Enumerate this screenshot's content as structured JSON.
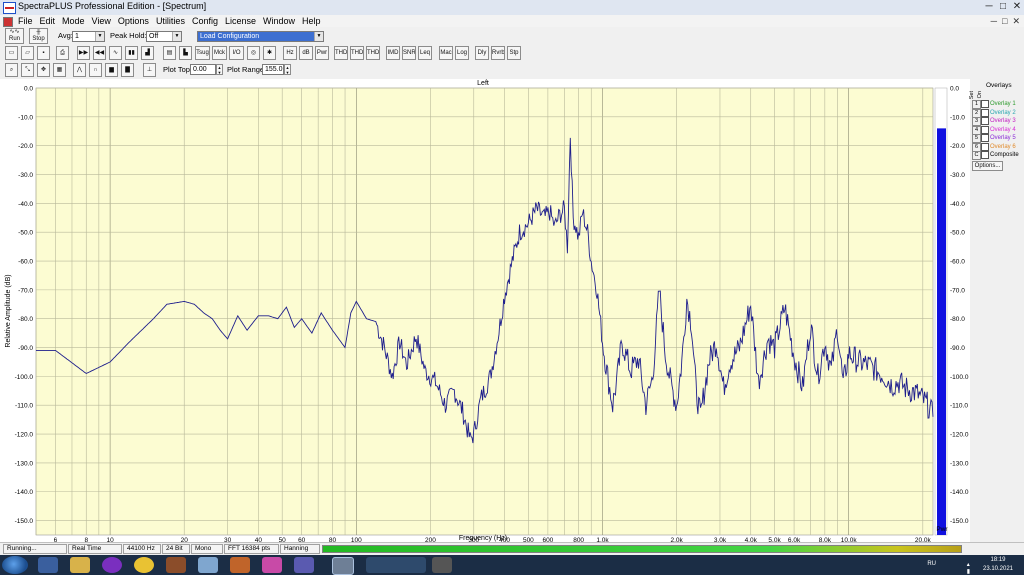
{
  "window": {
    "title": "SpectraPLUS Professional Edition - [Spectrum]",
    "buttons": [
      "─",
      "□",
      "✕"
    ]
  },
  "menu": {
    "items": [
      "File",
      "Edit",
      "Mode",
      "View",
      "Options",
      "Utilities",
      "Config",
      "License",
      "Window",
      "Help"
    ],
    "mdi_buttons": [
      "─",
      "□",
      "✕"
    ]
  },
  "toolbar1": {
    "run": "Run",
    "stop": "Stop",
    "avg_label": "Avg:",
    "avg_value": "1",
    "peak_hold_label": "Peak Hold:",
    "peak_hold_value": "Off",
    "config_value": "Load Configuration"
  },
  "toolbar2": {
    "buttons": [
      "Tsug",
      "Mck",
      "I/O",
      "Hz",
      "dB",
      "Pwr",
      "THD",
      "THD+N",
      "THD Freq",
      "IMD",
      "SNR",
      "Leq",
      "Mac",
      "Log",
      "Dly",
      "Rvrb",
      "Stp"
    ]
  },
  "toolbar3": {
    "plot_top_label": "Plot Top:",
    "plot_top_value": "0.00",
    "plot_range_label": "Plot Range:",
    "plot_range_value": "155.0"
  },
  "plot": {
    "title": "Left",
    "pwr_label": "Pwr"
  },
  "overlays": {
    "header": "Overlays",
    "set_label": "Set",
    "on_label": "On",
    "items": [
      {
        "num": "1",
        "name": "Overlay 1",
        "color": "#2e9b2e"
      },
      {
        "num": "2",
        "name": "Overlay 2",
        "color": "#2aa7b0"
      },
      {
        "num": "3",
        "name": "Overlay 3",
        "color": "#c21fc2"
      },
      {
        "num": "4",
        "name": "Overlay 4",
        "color": "#d62bd6"
      },
      {
        "num": "5",
        "name": "Overlay 5",
        "color": "#8a2bd6"
      },
      {
        "num": "6",
        "name": "Overlay 6",
        "color": "#e08a2c"
      },
      {
        "num": "C",
        "name": "Composite",
        "color": "#000000"
      }
    ],
    "options_button": "Options..."
  },
  "status": {
    "items": [
      "Running...",
      "Real Time",
      "44100 Hz",
      "24 Bit",
      "Mono",
      "FFT 16384 pts",
      "Hanning"
    ]
  },
  "taskbar": {
    "lang": "RU",
    "time": "18:19",
    "date": "23.10.2021"
  },
  "chart_data": {
    "type": "line",
    "title": "Left",
    "xlabel": "Frequency (Hz)",
    "ylabel": "Relative Amplitude (dB)",
    "xscale": "log",
    "xlim": [
      5,
      22000
    ],
    "ylim": [
      -155,
      0
    ],
    "x_ticks": [
      "6",
      "8",
      "10",
      "20",
      "30",
      "40",
      "50",
      "60",
      "80",
      "100",
      "200",
      "300",
      "400",
      "500",
      "600",
      "800",
      "1.0k",
      "2.0k",
      "3.0k",
      "4.0k",
      "5.0k",
      "6.0k",
      "8.0k",
      "10.0k",
      "20.0k"
    ],
    "x_tick_values": [
      6,
      8,
      10,
      20,
      30,
      40,
      50,
      60,
      80,
      100,
      200,
      300,
      400,
      500,
      600,
      800,
      1000,
      2000,
      3000,
      4000,
      5000,
      6000,
      8000,
      10000,
      20000
    ],
    "y_ticks": [
      "0.0",
      "-10.0",
      "-20.0",
      "-30.0",
      "-40.0",
      "-50.0",
      "-60.0",
      "-70.0",
      "-80.0",
      "-90.0",
      "-100.0",
      "-110.0",
      "-120.0",
      "-130.0",
      "-140.0",
      "-150.0"
    ],
    "y_tick_values": [
      0,
      -10,
      -20,
      -30,
      -40,
      -50,
      -60,
      -70,
      -80,
      -90,
      -100,
      -110,
      -120,
      -130,
      -140,
      -150
    ],
    "grid": true,
    "pwr_level_db": -14,
    "series": [
      {
        "color": "#1e1e8c",
        "x": [
          5,
          6,
          8,
          10,
          12,
          15,
          17,
          20,
          22,
          24,
          26,
          28,
          30,
          33,
          36,
          40,
          44,
          48,
          52,
          56,
          60,
          66,
          72,
          80,
          90,
          95,
          100,
          110,
          120,
          130,
          140,
          150,
          160,
          175,
          190,
          210,
          230,
          250,
          270,
          290,
          300,
          320,
          350,
          380,
          400,
          430,
          460,
          500,
          540,
          580,
          610,
          640,
          670,
          700,
          720,
          740,
          760,
          780,
          800,
          830,
          870,
          900,
          950,
          1000,
          1050,
          1100,
          1150,
          1200,
          1300,
          1400,
          1500,
          1600,
          1700,
          1800,
          1900,
          2000,
          2100,
          2200,
          2300,
          2400,
          2500,
          2700,
          2900,
          3100,
          3300,
          3600,
          4000,
          4300,
          4700,
          5000,
          5500,
          6000,
          6500,
          7000,
          7500,
          8000,
          8500,
          9000,
          9500,
          10000,
          11000,
          12000,
          13000,
          14000,
          15000,
          16000,
          17000,
          18000,
          19000,
          20000,
          21000,
          22000
        ],
        "y": [
          -91,
          -91,
          -99,
          -95,
          -88,
          -80,
          -75,
          -74,
          -75,
          -78,
          -80,
          -84,
          -87,
          -79,
          -84,
          -79,
          -79,
          -80,
          -76,
          -83,
          -80,
          -85,
          -78,
          -84,
          -90,
          -78,
          -74,
          -80,
          -81,
          -90,
          -100,
          -88,
          -96,
          -86,
          -98,
          -102,
          -110,
          -105,
          -112,
          -122,
          -120,
          -108,
          -100,
          -84,
          -72,
          -60,
          -50,
          -47,
          -42,
          -45,
          -43,
          -48,
          -44,
          -42,
          -55,
          -16,
          -45,
          -48,
          -52,
          -43,
          -50,
          -60,
          -70,
          -88,
          -100,
          -110,
          -100,
          -88,
          -98,
          -94,
          -110,
          -100,
          -70,
          -92,
          -103,
          -110,
          -95,
          -73,
          -82,
          -105,
          -114,
          -95,
          -88,
          -104,
          -95,
          -90,
          -75,
          -102,
          -87,
          -90,
          -76,
          -93,
          -104,
          -82,
          -100,
          -88,
          -98,
          -83,
          -103,
          -92,
          -95,
          -96,
          -98,
          -100,
          -103,
          -102,
          -104,
          -105,
          -106,
          -108,
          -110,
          -114
        ]
      }
    ]
  }
}
